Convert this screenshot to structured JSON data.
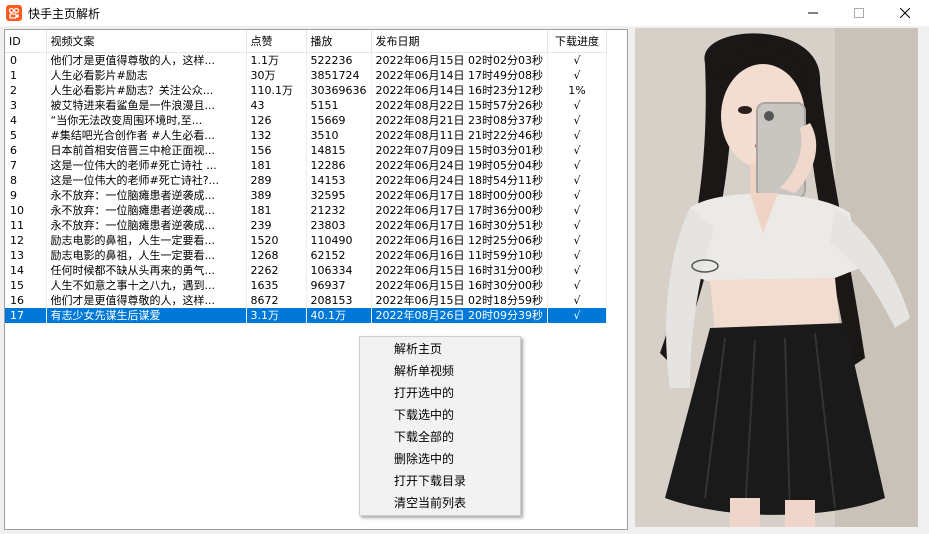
{
  "window": {
    "title": "快手主页解析"
  },
  "table": {
    "headers": [
      "ID",
      "视频文案",
      "点赞",
      "播放",
      "发布日期",
      "下载进度"
    ],
    "rows": [
      [
        "0",
        "他们才是更值得尊敬的人，这样...",
        "1.1万",
        "522236",
        "2022年06月15日 02时02分03秒",
        "√"
      ],
      [
        "1",
        "人生必看影片#励志",
        "30万",
        "3851724",
        "2022年06月14日 17时49分08秒",
        "√"
      ],
      [
        "2",
        "人生必看影片#励志？关注公众...",
        "110.1万",
        "30369636",
        "2022年06月14日 16时23分12秒",
        "1%"
      ],
      [
        "3",
        "被艾特进来看鲨鱼是一件浪漫且...",
        "43",
        "5151",
        "2022年08月22日 15时57分26秒",
        "√"
      ],
      [
        "4",
        "“当你无法改变周围环境时,至...",
        "126",
        "15669",
        "2022年08月21日 23时08分37秒",
        "√"
      ],
      [
        "5",
        "#集结吧光合创作者 #人生必看...",
        "132",
        "3510",
        "2022年08月11日 21时22分46秒",
        "√"
      ],
      [
        "6",
        "日本前首相安倍晋三中枪正面视...",
        "156",
        "14815",
        "2022年07月09日 15时03分01秒",
        "√"
      ],
      [
        "7",
        "这是一位伟大的老师#死亡诗社 ...",
        "181",
        "12286",
        "2022年06月24日 19时05分04秒",
        "√"
      ],
      [
        "8",
        "这是一位伟大的老师#死亡诗社?...",
        "289",
        "14153",
        "2022年06月24日 18时54分11秒",
        "√"
      ],
      [
        "9",
        "永不放弃：一位脑瘫患者逆袭成...",
        "389",
        "32595",
        "2022年06月17日 18时00分00秒",
        "√"
      ],
      [
        "10",
        "永不放弃：一位脑瘫患者逆袭成...",
        "181",
        "21232",
        "2022年06月17日 17时36分00秒",
        "√"
      ],
      [
        "11",
        "永不放弃：一位脑瘫患者逆袭成...",
        "239",
        "23803",
        "2022年06月17日 16时30分51秒",
        "√"
      ],
      [
        "12",
        "励志电影的鼻祖，人生一定要看...",
        "1520",
        "110490",
        "2022年06月16日 12时25分06秒",
        "√"
      ],
      [
        "13",
        "励志电影的鼻祖，人生一定要看...",
        "1268",
        "62152",
        "2022年06月16日 11时59分10秒",
        "√"
      ],
      [
        "14",
        "任何时候都不缺从头再来的勇气...",
        "2262",
        "106334",
        "2022年06月15日 16时31分00秒",
        "√"
      ],
      [
        "15",
        "人生不如意之事十之八九，遇到...",
        "1635",
        "96937",
        "2022年06月15日 16时30分00秒",
        "√"
      ],
      [
        "16",
        "他们才是更值得尊敬的人，这样...",
        "8672",
        "208153",
        "2022年06月15日 02时18分59秒",
        "√"
      ],
      [
        "17",
        "有志少女先谋生后谋爱",
        "3.1万",
        "40.1万",
        "2022年08月26日 20时09分39秒",
        "√"
      ]
    ],
    "selected_row": 17
  },
  "context_menu": {
    "items": [
      "解析主页",
      "解析单视频",
      "打开选中的",
      "下载选中的",
      "下载全部的",
      "删除选中的",
      "打开下载目录",
      "清空当前列表"
    ]
  },
  "colors": {
    "selection": "#0078d7",
    "app_icon": "#ff5a1f"
  },
  "icons": {
    "app": "kuaishou-logo-icon",
    "preview": "photo-preview"
  }
}
